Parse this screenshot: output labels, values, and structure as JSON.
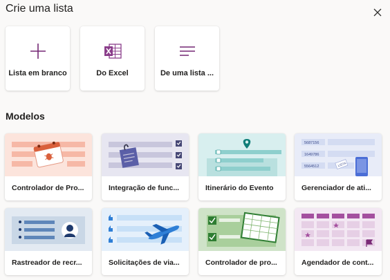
{
  "dialog": {
    "title": "Crie uma lista",
    "close_icon": "close-icon"
  },
  "start_options": [
    {
      "label": "Lista em branco",
      "icon": "plus-icon"
    },
    {
      "label": "Do Excel",
      "icon": "excel-icon"
    },
    {
      "label": "De uma lista ...",
      "icon": "list-lines-icon"
    }
  ],
  "templates_section": {
    "title": "Modelos",
    "items": [
      {
        "label": "Controlador de Pro..."
      },
      {
        "label": "Integração de func..."
      },
      {
        "label": "Itinerário do Evento"
      },
      {
        "label": "Gerenciador de ati..."
      },
      {
        "label": "Rastreador de recr..."
      },
      {
        "label": "Solicitações de via..."
      },
      {
        "label": "Controlador de pro..."
      },
      {
        "label": "Agendador de cont..."
      }
    ],
    "thumbnail_text": {
      "asset_numbers": [
        "5687156",
        "1649786",
        "5564512"
      ],
      "tag": "LISTA"
    }
  },
  "colors": {
    "accent": "#742774",
    "excel_purple": "#8a3d8a"
  }
}
